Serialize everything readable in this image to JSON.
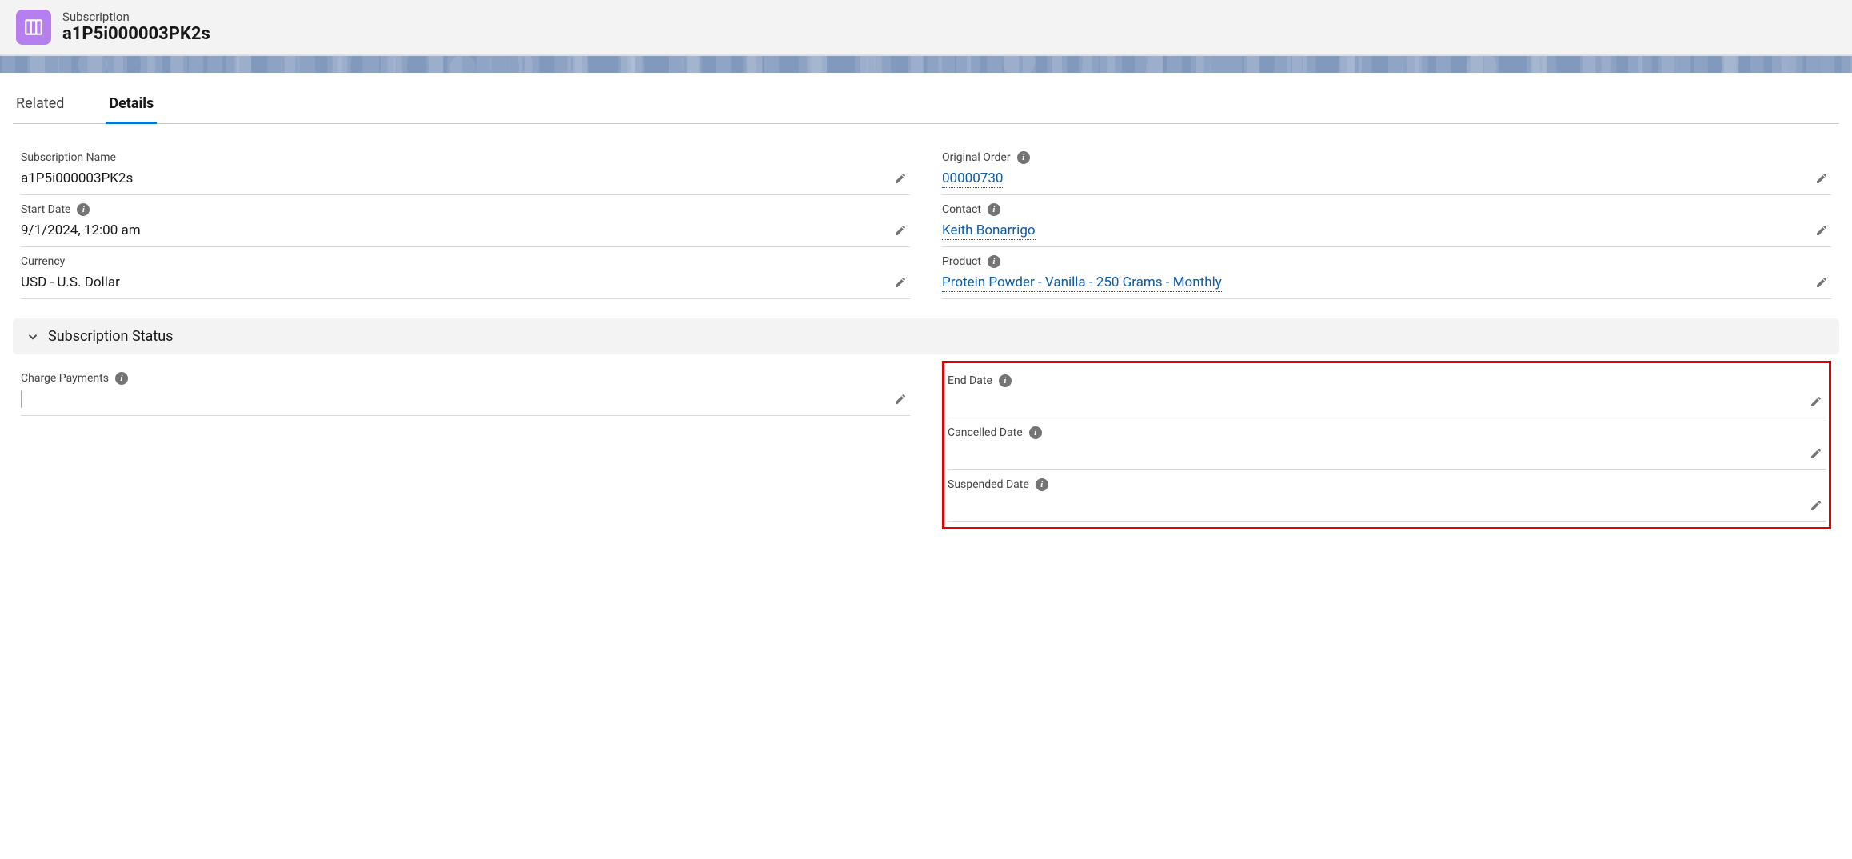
{
  "header": {
    "entity_type": "Subscription",
    "entity_name": "a1P5i000003PK2s"
  },
  "tabs": {
    "related": "Related",
    "details": "Details"
  },
  "fields": {
    "subscription_name": {
      "label": "Subscription Name",
      "value": "a1P5i000003PK2s"
    },
    "start_date": {
      "label": "Start Date",
      "value": "9/1/2024, 12:00 am"
    },
    "currency": {
      "label": "Currency",
      "value": "USD - U.S. Dollar"
    },
    "original_order": {
      "label": "Original Order",
      "value": "00000730"
    },
    "contact": {
      "label": "Contact",
      "value": "Keith Bonarrigo"
    },
    "product": {
      "label": "Product",
      "value": "Protein Powder - Vanilla - 250 Grams - Monthly"
    },
    "charge_payments": {
      "label": "Charge Payments"
    },
    "end_date": {
      "label": "End Date",
      "value": ""
    },
    "cancelled_date": {
      "label": "Cancelled Date",
      "value": ""
    },
    "suspended_date": {
      "label": "Suspended Date",
      "value": ""
    }
  },
  "sections": {
    "subscription_status": "Subscription Status"
  }
}
